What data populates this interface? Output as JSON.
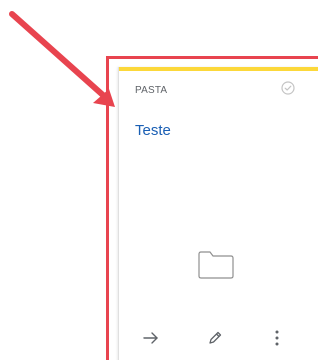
{
  "card": {
    "type_label": "PASTA",
    "title": "Teste",
    "accent_color": "#fcd83a",
    "title_color": "#1a5fb4"
  },
  "icons": {
    "check": "check-circle-icon",
    "folder": "folder-icon",
    "open": "arrow-right-icon",
    "edit": "pencil-icon",
    "more": "more-vertical-icon"
  },
  "annotation": {
    "color": "#e8444f"
  }
}
